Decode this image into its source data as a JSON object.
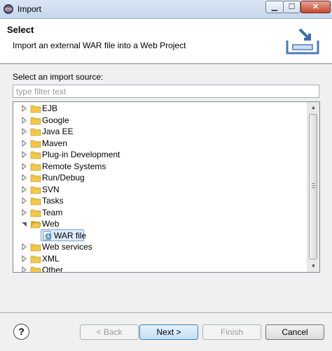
{
  "window": {
    "title": "Import"
  },
  "header": {
    "title": "Select",
    "description": "Import an external WAR file into a Web Project",
    "icon": "import-wizard-icon"
  },
  "source": {
    "label": "Select an import source:",
    "filter_placeholder": "type filter text",
    "filter_value": ""
  },
  "tree": {
    "items": [
      {
        "label": "EJB",
        "expanded": false
      },
      {
        "label": "Google",
        "expanded": false
      },
      {
        "label": "Java EE",
        "expanded": false
      },
      {
        "label": "Maven",
        "expanded": false
      },
      {
        "label": "Plug-in Development",
        "expanded": false
      },
      {
        "label": "Remote Systems",
        "expanded": false
      },
      {
        "label": "Run/Debug",
        "expanded": false
      },
      {
        "label": "SVN",
        "expanded": false
      },
      {
        "label": "Tasks",
        "expanded": false
      },
      {
        "label": "Team",
        "expanded": false
      },
      {
        "label": "Web",
        "expanded": true
      },
      {
        "label": "WAR file",
        "child": true,
        "selected": true
      },
      {
        "label": "Web services",
        "expanded": false
      },
      {
        "label": "XML",
        "expanded": false
      },
      {
        "label": "Other",
        "expanded": false
      }
    ]
  },
  "buttons": {
    "back": "< Back",
    "next": "Next >",
    "finish": "Finish",
    "cancel": "Cancel"
  },
  "colors": {
    "folder": "#f2c94c",
    "selection": "#dcebfc",
    "titlebar": "#c6d6ec"
  }
}
